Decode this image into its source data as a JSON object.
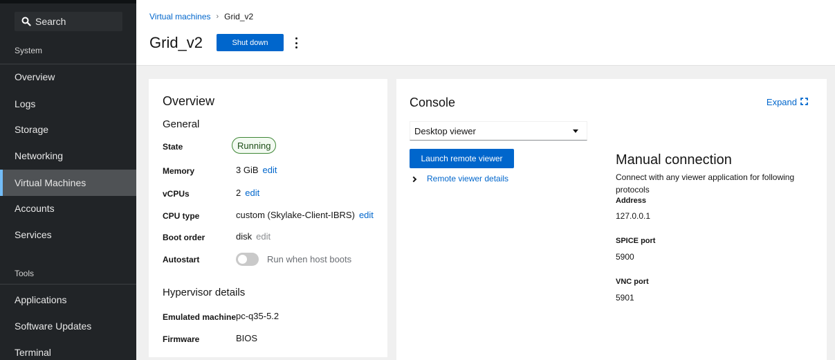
{
  "sidebar": {
    "search_label": "Search",
    "system_label": "System",
    "tools_label": "Tools",
    "items": [
      {
        "label": "Overview"
      },
      {
        "label": "Logs"
      },
      {
        "label": "Storage"
      },
      {
        "label": "Networking"
      },
      {
        "label": "Virtual Machines",
        "active": true
      },
      {
        "label": "Accounts"
      },
      {
        "label": "Services"
      }
    ],
    "tool_items": [
      {
        "label": "Applications"
      },
      {
        "label": "Software Updates"
      },
      {
        "label": "Terminal"
      }
    ]
  },
  "header": {
    "breadcrumb_parent": "Virtual machines",
    "breadcrumb_current": "Grid_v2",
    "title": "Grid_v2",
    "shutdown_label": "Shut down"
  },
  "overview": {
    "title": "Overview",
    "general_title": "General",
    "state_label": "State",
    "state_value": "Running",
    "memory_label": "Memory",
    "memory_value": "3 GiB",
    "vcpus_label": "vCPUs",
    "vcpus_value": "2",
    "cpu_type_label": "CPU type",
    "cpu_type_value": "custom (Skylake-Client-IBRS)",
    "boot_order_label": "Boot order",
    "boot_order_value": "disk",
    "autostart_label": "Autostart",
    "autostart_toggle_label": "Run when host boots",
    "edit_label": "edit",
    "hypervisor_title": "Hypervisor details",
    "emulated_label": "Emulated machine",
    "emulated_value": "pc-q35-5.2",
    "firmware_label": "Firmware",
    "firmware_value": "BIOS"
  },
  "console": {
    "title": "Console",
    "expand_label": "Expand",
    "viewer_selected": "Desktop viewer",
    "launch_label": "Launch remote viewer",
    "remote_details_label": "Remote viewer details",
    "manual_title": "Manual connection",
    "manual_desc": "Connect with any viewer application for following protocols",
    "address_label": "Address",
    "address_value": "127.0.0.1",
    "spice_label": "SPICE port",
    "spice_value": "5900",
    "vnc_label": "VNC port",
    "vnc_value": "5901"
  },
  "colors": {
    "sidebar_bg": "#212427",
    "accent": "#0066cc",
    "running_badge": "#3e8635"
  }
}
